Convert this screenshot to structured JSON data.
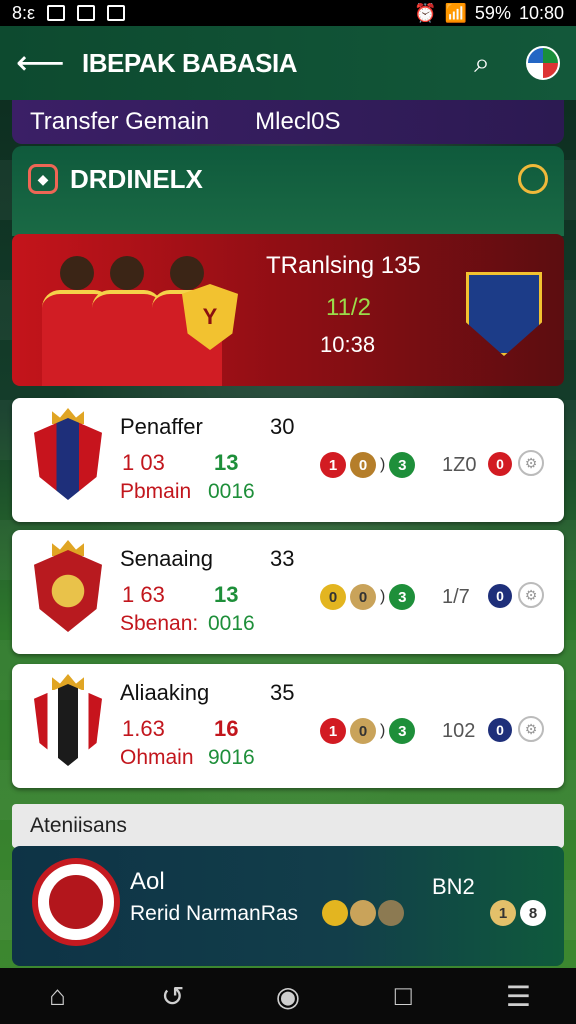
{
  "statusbar": {
    "time_left": "8:ε",
    "battery": "59%",
    "time_right": "10:80"
  },
  "appbar": {
    "back_icon": "arrow-left-icon",
    "title": "IBEPAK BABASIA",
    "search_icon": "search-icon"
  },
  "tabs": [
    {
      "label": "Transfer Gemain"
    },
    {
      "label": "Mlecl0S"
    }
  ],
  "section": {
    "title": "DRDINELX"
  },
  "hero": {
    "title": "TRanlsing 135",
    "score": "11/2",
    "time": "10:38"
  },
  "cards": [
    {
      "team": "Penaffer",
      "count": "30",
      "s1": "1 03",
      "s2": "13",
      "s3": "Pbmain",
      "s4": "0016",
      "form": [
        "1",
        "0",
        ")",
        "3"
      ],
      "odds": "1Z0",
      "odot": "0",
      "badge_color": "#c7141d",
      "odot_color": "#d21b22"
    },
    {
      "team": "Senaaing",
      "count": "33",
      "s1": "1 63",
      "s2": "13",
      "s3": "Sbenan:",
      "s4": "0016",
      "form": [
        "0",
        "0",
        ")",
        "3"
      ],
      "odds": "1/7",
      "odot": "0",
      "badge_color": "#b81a1f",
      "odot_color": "#1e2f7a"
    },
    {
      "team": "Aliaaking",
      "count": "35",
      "s1": "1.63",
      "s2": "16",
      "s3": "Ohmain",
      "s4": "9016",
      "form": [
        "1",
        "0",
        ")",
        "3"
      ],
      "odds": "102",
      "odot": "0",
      "badge_color": "#c7141d",
      "odot_color": "#1e2f7a"
    }
  ],
  "strip": {
    "label": "Ateniisans"
  },
  "bottom": {
    "line1": "Aol",
    "line2": "Rerid NarmanRas",
    "score": "BN2",
    "dots": [
      "1",
      "8"
    ]
  },
  "nav": {
    "items": [
      "home-icon",
      "refresh-icon",
      "camera-icon",
      "square-icon",
      "menu-icon"
    ]
  }
}
